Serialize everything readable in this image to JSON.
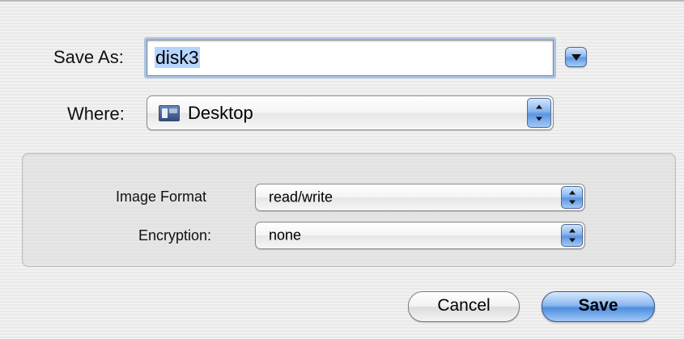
{
  "dialog": {
    "save_as_label": "Save As:",
    "filename_value": "disk3",
    "where_label": "Where:",
    "where_value": "Desktop"
  },
  "options": {
    "image_format_label": "Image Format",
    "image_format_value": "read/write",
    "encryption_label": "Encryption:",
    "encryption_value": "none"
  },
  "buttons": {
    "cancel_label": "Cancel",
    "save_label": "Save"
  },
  "icons": {
    "disclosure": "disclosure-triangle-icon",
    "location": "desktop-folder-icon",
    "popup_arrows": "up-down-arrows-icon"
  },
  "colors": {
    "accent": "#5e97e3",
    "selection": "#b5d5ff",
    "focus_ring": "#a9c4e4"
  }
}
